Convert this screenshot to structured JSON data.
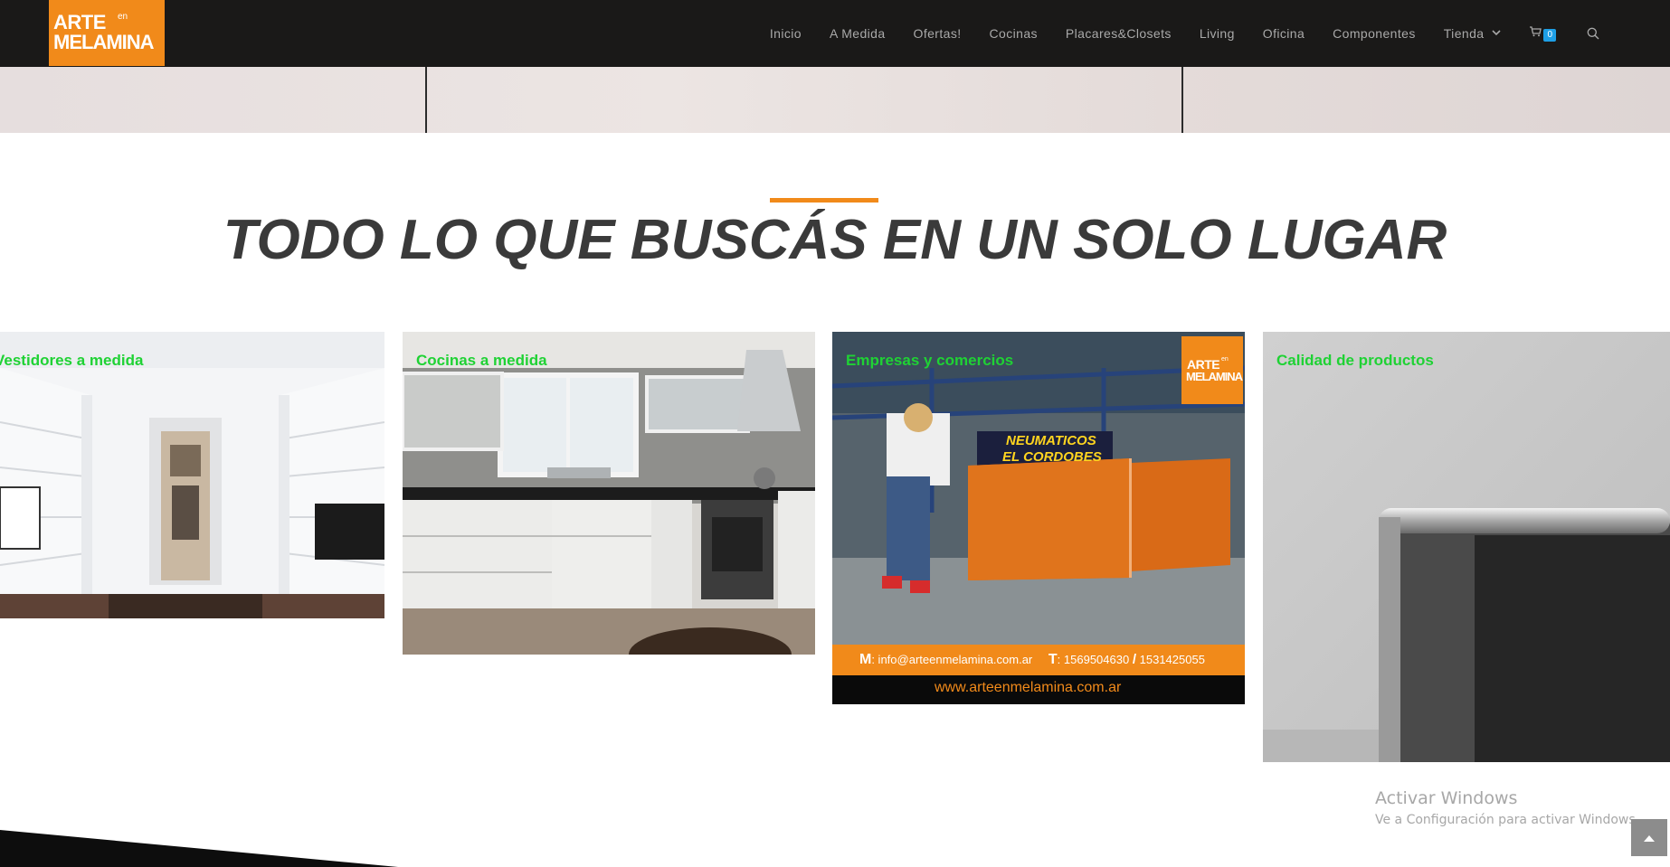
{
  "logo": {
    "line1": "ARTE",
    "en": "en",
    "line2": "MELAMINA"
  },
  "nav": {
    "items": [
      "Inicio",
      "A Medida",
      "Ofertas!",
      "Cocinas",
      "Placares&Closets",
      "Living",
      "Oficina",
      "Componentes",
      "Tienda"
    ],
    "tienda_chevron": "chevron-down-icon",
    "cart_icon": "cart-icon",
    "cart_count": "0",
    "search_icon": "search-icon"
  },
  "section": {
    "title": "TODO LO QUE BUSCÁS EN UN SOLO LUGAR"
  },
  "cards": [
    {
      "label": "Vestidores a medida"
    },
    {
      "label": "Cocinas a medida"
    },
    {
      "label": "Empresas y comercios",
      "badge_line1": "ARTE",
      "badge_en": "en",
      "badge_line2": "MELAMINA",
      "sign_line1": "NEUMATICOS",
      "sign_line2": "EL CORDOBES",
      "contact_m": "M",
      "contact_email": ": info@arteenmelamina.com.ar",
      "contact_t": "T",
      "contact_phones": ": 1569504630",
      "contact_sep": "/",
      "contact_phone2": "1531425055",
      "website": "www.arteenmelamina.com.ar"
    },
    {
      "label": "Calidad de productos"
    }
  ],
  "watermark": {
    "title": "Activar Windows",
    "subtitle": "Ve a Configuración para activar Windows."
  },
  "colors": {
    "accent": "#f18a1a",
    "header_bg": "#1a1918",
    "label_green": "#1fd234",
    "badge_blue": "#1e9fe6"
  }
}
